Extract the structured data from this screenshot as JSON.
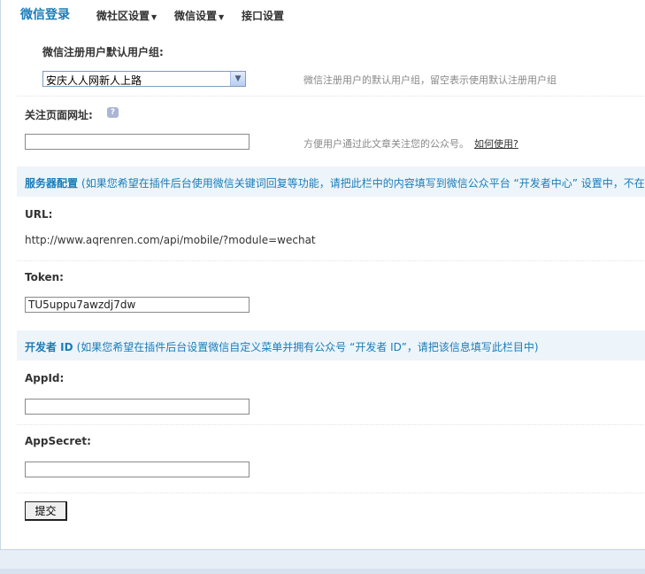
{
  "nav": {
    "title": "微信登录",
    "menus": [
      {
        "label": "微社区设置",
        "has_dropdown": true
      },
      {
        "label": "微信设置",
        "has_dropdown": true
      },
      {
        "label": "接口设置",
        "has_dropdown": false
      }
    ],
    "dropdown_arrow": "▼"
  },
  "default_group": {
    "label": "微信注册用户默认用户组:",
    "selected": "安庆人人网新人上路",
    "hint": "微信注册用户的默认用户组，留空表示使用默认注册用户组"
  },
  "follow_url": {
    "label": "关注页面网址:",
    "value": "",
    "hint": "方便用户通过此文章关注您的公众号。",
    "help_link": "如何使用?"
  },
  "server_section": {
    "title": "服务器配置",
    "desc": "(如果您希望在插件后台使用微信关键词回复等功能，请把此栏中的内容填写到微信公众平台 “开发者中心” 设置中，不在"
  },
  "url": {
    "label": "URL:",
    "value": "http://www.aqrenren.com/api/mobile/?module=wechat"
  },
  "token": {
    "label": "Token:",
    "value": "TU5uppu7awzdj7dw"
  },
  "dev_section": {
    "title": "开发者  ID",
    "desc": "(如果您希望在插件后台设置微信自定义菜单并拥有公众号 “开发者 ID”，请把该信息填写此栏目中)"
  },
  "appid": {
    "label": "AppId:",
    "value": ""
  },
  "appsecret": {
    "label": "AppSecret:",
    "value": ""
  },
  "submit_label": "提交",
  "icons": {
    "help": "?",
    "select_arrow": "▼"
  }
}
